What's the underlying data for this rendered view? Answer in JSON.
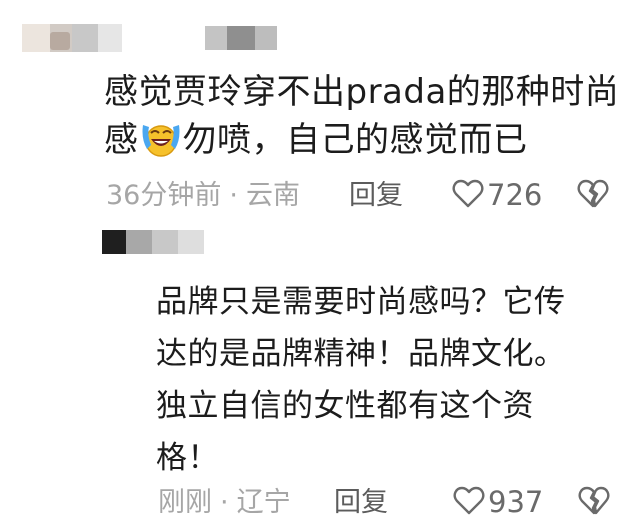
{
  "comment": {
    "line1": "感觉贾玲穿不出prada的那种时尚",
    "line2_before_emoji": "感",
    "line2_after_emoji": "勿喷，自己的感觉而已",
    "emoji": "laughing-crying-emoji",
    "time": "36分钟前",
    "separator": "·",
    "location": "云南",
    "reply_label": "回复",
    "like_count": "726"
  },
  "reply": {
    "lines": [
      "品牌只是需要时尚感吗？它传",
      "达的是品牌精神！品牌文化。",
      "独立自信的女性都有这个资",
      "格！"
    ],
    "time": "刚刚",
    "separator": "·",
    "location": "辽宁",
    "reply_label": "回复",
    "like_count": "937"
  },
  "colors": {
    "text": "#1c1c1c",
    "meta": "#a6a6a6",
    "action": "#5c5c5c",
    "icon": "#6a6a6a"
  },
  "icons": [
    "heart-icon",
    "broken-heart-icon"
  ]
}
